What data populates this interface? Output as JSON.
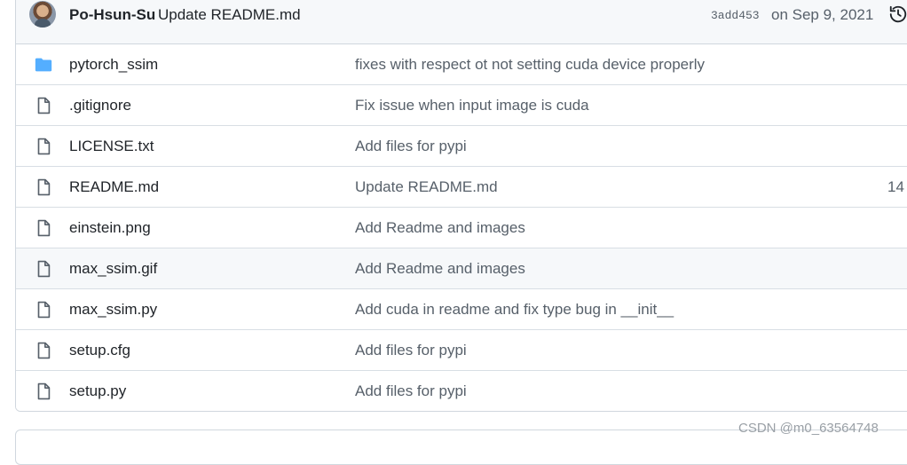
{
  "commit": {
    "author": "Po-Hsun-Su",
    "message": "Update README.md",
    "sha": "3add453",
    "date": "on Sep 9, 2021"
  },
  "files": [
    {
      "name": "pytorch_ssim",
      "type": "folder",
      "icon": "folder-icon",
      "commit": "fixes with respect ot not setting cuda device properly",
      "age": ""
    },
    {
      "name": ".gitignore",
      "type": "file",
      "icon": "file-icon",
      "commit": "Fix issue when input image is cuda",
      "age": ""
    },
    {
      "name": "LICENSE.txt",
      "type": "file",
      "icon": "file-icon",
      "commit": "Add files for pypi",
      "age": ""
    },
    {
      "name": "README.md",
      "type": "file",
      "icon": "file-icon",
      "commit": "Update README.md",
      "age": "14"
    },
    {
      "name": "einstein.png",
      "type": "file",
      "icon": "file-icon",
      "commit": "Add Readme and images",
      "age": ""
    },
    {
      "name": "max_ssim.gif",
      "type": "file",
      "icon": "file-icon",
      "commit": "Add Readme and images",
      "age": ""
    },
    {
      "name": "max_ssim.py",
      "type": "file",
      "icon": "file-icon",
      "commit": "Add cuda in readme and fix type bug in __init__",
      "age": ""
    },
    {
      "name": "setup.cfg",
      "type": "file",
      "icon": "file-icon",
      "commit": "Add files for pypi",
      "age": ""
    },
    {
      "name": "setup.py",
      "type": "file",
      "icon": "file-icon",
      "commit": "Add files for pypi",
      "age": ""
    }
  ],
  "watermark": "CSDN @m0_63564748",
  "colors": {
    "folder": "#54aeff",
    "icon": "#57606a",
    "border": "#d0d7de",
    "header_bg": "#f6f8fa"
  }
}
